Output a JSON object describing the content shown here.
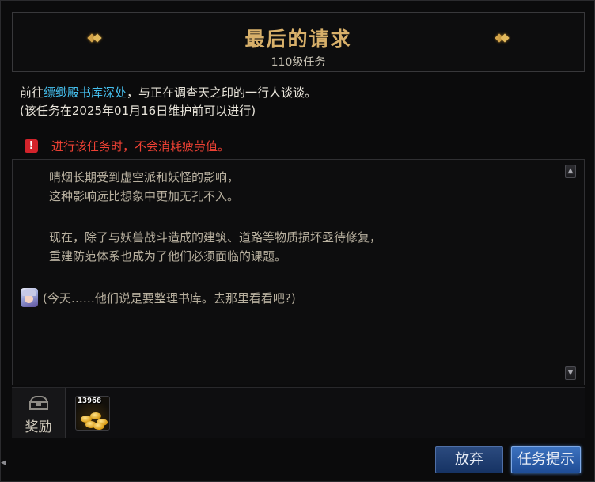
{
  "header": {
    "title": "最后的请求",
    "subtitle": "110级任务"
  },
  "description": {
    "prefix": "前往",
    "place": "缥缈殿书库深处",
    "suffix": "，与正在调查天之印的一行人谈谈。",
    "note": "(该任务在2025年01月16日维护前可以进行)"
  },
  "warning": {
    "text": "进行该任务时，不会消耗疲劳值。"
  },
  "story": {
    "paragraph1": [
      "晴烟长期受到虚空派和妖怪的影响，",
      "这种影响远比想象中更加无孔不入。"
    ],
    "paragraph2": [
      "现在，除了与妖兽战斗造成的建筑、道路等物质损坏亟待修复，",
      "重建防范体系也成为了他们必须面临的课题。"
    ],
    "dialog": "(今天……他们说是要整理书库。去那里看看吧?)"
  },
  "rewards": {
    "tab_label": "奖励",
    "items": [
      {
        "icon": "gold-coins-icon",
        "quantity": "13968"
      }
    ]
  },
  "buttons": {
    "abandon": "放弃",
    "hint": "任务提示"
  },
  "colors": {
    "title": "#d8b06a",
    "place_link": "#46c0ef",
    "warning": "#ee4134",
    "button_primary": "#2f5fae"
  }
}
